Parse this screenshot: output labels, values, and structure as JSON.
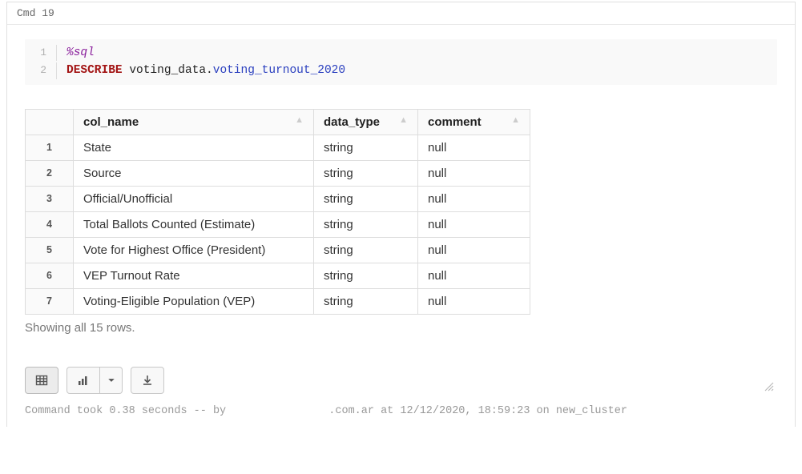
{
  "cell": {
    "header": "Cmd 19",
    "code": {
      "line1": {
        "num": "1",
        "magic": "%sql"
      },
      "line2": {
        "num": "2",
        "keyword": "DESCRIBE",
        "prefix": " voting_data.",
        "table": "voting_turnout_2020"
      }
    }
  },
  "table": {
    "headers": {
      "col1": "col_name",
      "col2": "data_type",
      "col3": "comment"
    },
    "rows": [
      {
        "n": "1",
        "col_name": "State",
        "data_type": "string",
        "comment": "null"
      },
      {
        "n": "2",
        "col_name": "Source",
        "data_type": "string",
        "comment": "null"
      },
      {
        "n": "3",
        "col_name": "Official/Unofficial",
        "data_type": "string",
        "comment": "null"
      },
      {
        "n": "4",
        "col_name": "Total Ballots Counted (Estimate)",
        "data_type": "string",
        "comment": "null"
      },
      {
        "n": "5",
        "col_name": "Vote for Highest Office (President)",
        "data_type": "string",
        "comment": "null"
      },
      {
        "n": "6",
        "col_name": "VEP Turnout Rate",
        "data_type": "string",
        "comment": "null"
      },
      {
        "n": "7",
        "col_name": "Voting-Eligible Population (VEP)",
        "data_type": "string",
        "comment": "null"
      }
    ]
  },
  "rows_note": "Showing all 15 rows.",
  "run_meta": {
    "prefix": "Command took ",
    "duration": "0.38 seconds",
    "by": " -- by ",
    "user_suffix": ".com.ar",
    "at": " at ",
    "timestamp": "12/12/2020, 18:59:23",
    "on": " on ",
    "cluster": "new_cluster"
  }
}
